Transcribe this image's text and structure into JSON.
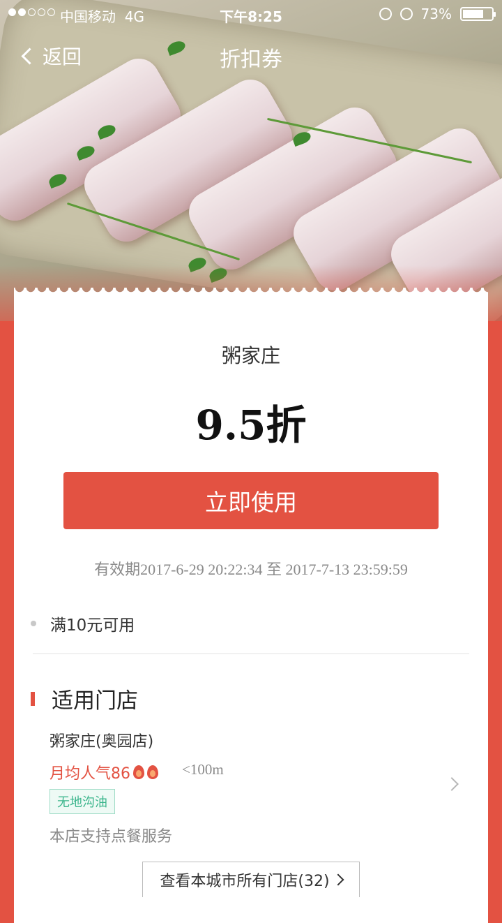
{
  "status_bar": {
    "carrier": "中国移动",
    "network": "4G",
    "time": "下午8:25",
    "battery": "73%",
    "battery_level": 0.73,
    "signal_bars_filled": 2,
    "signal_bars_total": 5
  },
  "nav": {
    "back_label": "返回",
    "title": "折扣券"
  },
  "coupon": {
    "shop_name": "粥家庄",
    "discount": "9.5折",
    "use_button": "立即使用",
    "validity": "有效期2017-6-29 20:22:34 至 2017-7-13 23:59:59",
    "condition": "满10元可用"
  },
  "stores_section": {
    "title": "适用门店",
    "store": {
      "name": "粥家庄(奥园店)",
      "popularity": "月均人气86",
      "distance": "<100m",
      "tag": "无地沟油",
      "service": "本店支持点餐服务"
    },
    "view_all": "查看本城市所有门店(32)"
  },
  "colors": {
    "accent": "#e35242",
    "tag_green": "#3bb58c"
  }
}
